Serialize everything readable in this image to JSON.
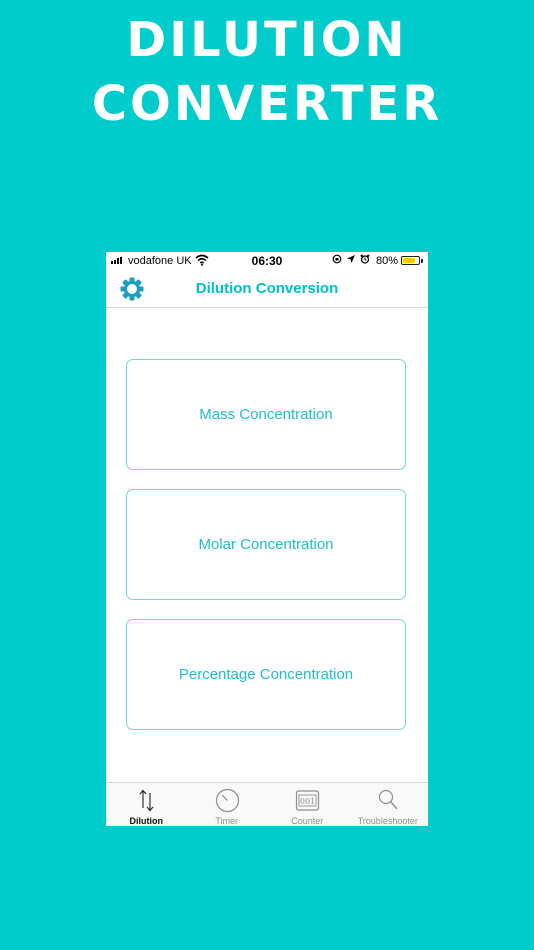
{
  "promo": {
    "title_line1": "DILUTION",
    "title_line2": "CONVERTER"
  },
  "status_bar": {
    "carrier": "vodafone UK",
    "time": "06:30",
    "battery_percent": "80%",
    "battery_level": 0.8
  },
  "nav": {
    "title": "Dilution Conversion",
    "settings_icon": "gear-icon"
  },
  "options": [
    {
      "label": "Mass Concentration"
    },
    {
      "label": "Molar Concentration"
    },
    {
      "label": "Percentage Concentration"
    }
  ],
  "tabs": [
    {
      "label": "Dilution",
      "icon": "up-down-arrows-icon",
      "active": true
    },
    {
      "label": "Timer",
      "icon": "stopwatch-icon",
      "active": false
    },
    {
      "label": "Counter",
      "icon": "counter-icon",
      "active": false
    },
    {
      "label": "Troubleshooter",
      "icon": "magnifier-icon",
      "active": false
    }
  ],
  "colors": {
    "background": "#00cccc",
    "accent": "#00c0cc",
    "card_border": "#6fd9de",
    "battery": "#ffcc00"
  }
}
